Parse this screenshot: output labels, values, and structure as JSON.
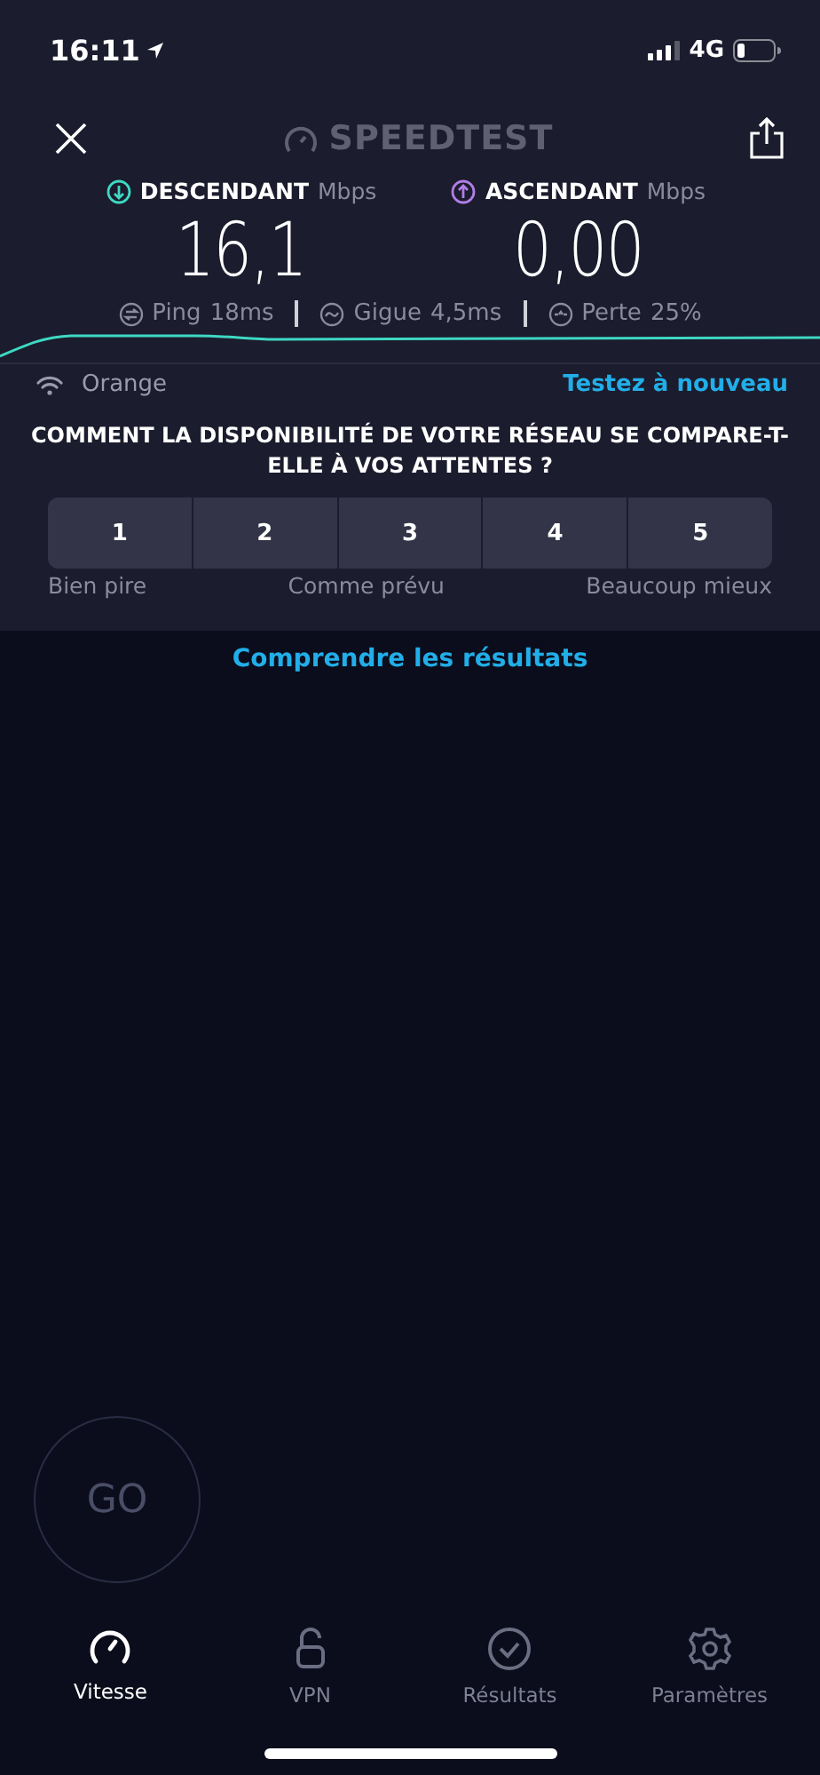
{
  "status_bar": {
    "time": "16:11",
    "network": "4G"
  },
  "header": {
    "title": "SPEEDTEST"
  },
  "metrics": [
    {
      "kind": "download",
      "label": "DESCENDANT",
      "unit": "Mbps",
      "value": "16,1",
      "color": "#3ed8c3"
    },
    {
      "kind": "upload",
      "label": "ASCENDANT",
      "unit": "Mbps",
      "value": "0,00",
      "color": "#b27de6"
    }
  ],
  "stats": [
    {
      "kind": "ping",
      "label": "Ping",
      "value": "18ms"
    },
    {
      "kind": "jitter",
      "label": "Gigue",
      "value": "4,5ms"
    },
    {
      "kind": "loss",
      "label": "Perte",
      "value": "25%"
    }
  ],
  "network": {
    "name": "Orange",
    "retry": "Testez à nouveau"
  },
  "survey": {
    "question": "COMMENT LA DISPONIBILITÉ DE VOTRE RÉSEAU SE COMPARE-T-ELLE À VOS ATTENTES ?",
    "options": [
      {
        "label": "1",
        "selected": false
      },
      {
        "label": "2",
        "selected": false
      },
      {
        "label": "3",
        "selected": false
      },
      {
        "label": "4",
        "selected": false
      },
      {
        "label": "5",
        "selected": false
      }
    ],
    "scale_labels": [
      "Bien pire",
      "Comme prévu",
      "Beaucoup mieux"
    ]
  },
  "results_link": "Comprendre les résultats",
  "go_button": "GO",
  "tabs": [
    {
      "kind": "speed",
      "label": "Vitesse",
      "selected": true
    },
    {
      "kind": "vpn",
      "label": "VPN",
      "selected": false
    },
    {
      "kind": "results",
      "label": "Résultats",
      "selected": false
    },
    {
      "kind": "settings",
      "label": "Paramètres",
      "selected": false
    }
  ]
}
